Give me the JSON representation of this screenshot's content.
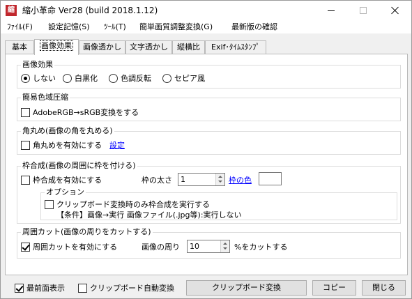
{
  "window": {
    "icon_glyph": "縮",
    "title": "縮小革命 Ver28  (build 2018.1.12)"
  },
  "menu": [
    {
      "label": "ﾌｧｲﾙ(F)"
    },
    {
      "label": "設定記憶(S)"
    },
    {
      "label": "ﾂｰﾙ(T)"
    },
    {
      "label": "簡単画質調整変換(G)"
    },
    {
      "label": "最新版の確認"
    }
  ],
  "tabs": [
    {
      "label": "基本"
    },
    {
      "label": "画像効果"
    },
    {
      "label": "画像透かし"
    },
    {
      "label": "文字透かし"
    },
    {
      "label": "縦横比"
    },
    {
      "label": "Exif･ﾀｲﾑｽﾀﾝﾌﾟ"
    }
  ],
  "effects": {
    "title": "画像効果",
    "options": [
      {
        "label": "しない",
        "selected": true
      },
      {
        "label": "白黒化",
        "selected": false
      },
      {
        "label": "色調反転",
        "selected": false
      },
      {
        "label": "セピア風",
        "selected": false
      }
    ]
  },
  "gamut": {
    "title": "簡易色域圧縮",
    "checkbox_label": "AdobeRGB→sRGB変換をする",
    "checked": false
  },
  "round": {
    "title": "角丸め(画像の角を丸める)",
    "checkbox_label": "角丸めを有効にする",
    "checked": false,
    "settings_link": "設定"
  },
  "frame": {
    "title": "枠合成(画像の周囲に枠を付ける)",
    "checkbox_label": "枠合成を有効にする",
    "checked": false,
    "width_label": "枠の太さ",
    "width_value": "1",
    "color_link": "枠の色",
    "options_title": "オプション",
    "clipboard_only_label": "クリップボード変換時のみ枠合成を実行する",
    "clipboard_only_checked": false,
    "condition_text": "【条件】画像→実行  画像ファイル(.jpg等):実行しない"
  },
  "cut": {
    "title": "周囲カット(画像の周りをカットする)",
    "checkbox_label": "周囲カットを有効にする",
    "checked": true,
    "around_label": "画像の周り",
    "value": "10",
    "suffix": "%をカットする"
  },
  "bottom": {
    "topmost_label": "最前面表示",
    "topmost_checked": true,
    "clipboard_auto_label": "クリップボード自動変換",
    "clipboard_auto_checked": false,
    "clipboard_button": "クリップボード変換",
    "copy_button": "コピー",
    "close_button": "閉じる"
  }
}
